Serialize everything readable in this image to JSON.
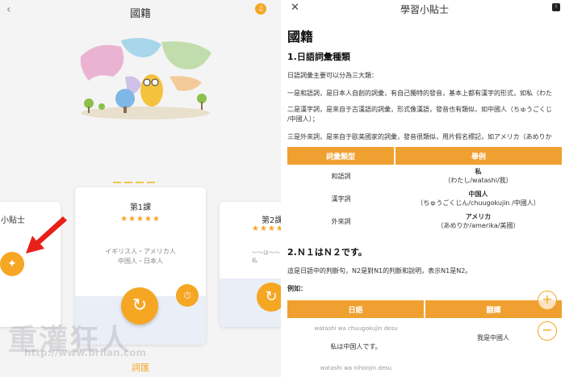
{
  "left": {
    "title": "國籍",
    "card_left": {
      "title": "學習小貼士"
    },
    "card_center": {
      "title": "第1課",
      "stars": "★★★★★",
      "line1": "イギリス人・アメリカ人",
      "line2": "中国人・日本人"
    },
    "card_right": {
      "title": "第2課",
      "stars": "★★★★",
      "line1": "〜〜は〜〜",
      "line2": "私"
    },
    "bottom_label": "詞匯",
    "watermark": "重灌狂人",
    "watermark_url": "http://www.briian.com"
  },
  "right": {
    "title": "學習小貼士",
    "heading": "國籍",
    "section1": "1.日語詞彙種類",
    "p1": "日語詞彙主要可以分為三大類：",
    "p2": "一是和語詞，是日本人自創的詞彙，有自己獨特的發音，基本上都有漢字的形式，如私（わた",
    "p3a": "二是漢字詞，是來自于古漢語的詞彙，形式像漢語，發音也有類似，如中國人（ちゅうごくじ",
    "p3b": "/中國人）；",
    "p4": "三是外來詞，是來自于歐美國家的詞彙，發音很類似，用片假名標記，如アメリカ（あめりか",
    "table1": {
      "headers": [
        "詞彙類型",
        "舉例"
      ],
      "rows": [
        {
          "type": "和語詞",
          "word": "私",
          "reading": "（わたし/watashi/我）"
        },
        {
          "type": "漢字詞",
          "word": "中国人",
          "reading": "（ちゅうごくじん/chuugokujin /中國人）"
        },
        {
          "type": "外來詞",
          "word": "アメリカ",
          "reading": "（あめりか/amerika/美國）"
        }
      ]
    },
    "section2": "2.Ｎ１はＮ２です。",
    "p5": "這是日語中的判斷句，N2是對N1的判斷和說明，表示N1是N2。",
    "example_label": "例如：",
    "table2": {
      "headers": [
        "日語",
        "翻譯"
      ],
      "rows": [
        {
          "romaji": "watashi wa chuugokujin desu",
          "jp": "私は中国人です。",
          "tr": "我是中國人"
        },
        {
          "romaji": "watashi wa nihonjin desu",
          "jp": "",
          "tr": ""
        }
      ]
    }
  }
}
